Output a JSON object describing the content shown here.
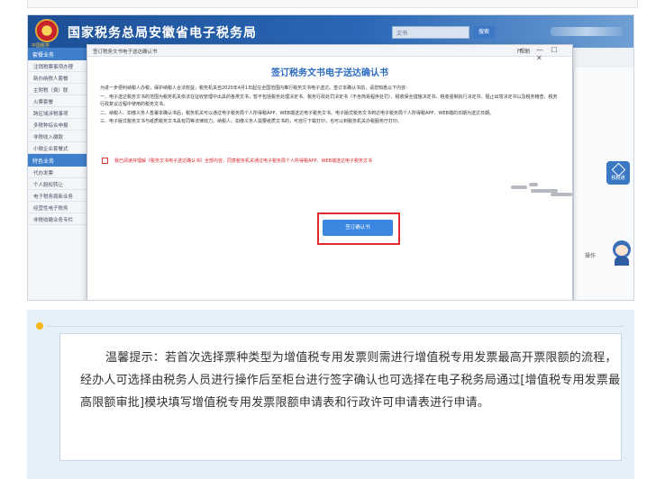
{
  "site": {
    "title": "国家税务总局安徽省电子税务局",
    "emblem_label": "中国税务",
    "search_placeholder": "文书",
    "search_button": "搜索"
  },
  "sidebar": {
    "section1": "套餐业务",
    "section1_items": [
      "注销税票事项办理",
      "新办纳税人套餐",
      "主附税（费）联",
      "火票套餐",
      "跨区域涉税事项",
      "多税种综合申报",
      "非税收入缴款",
      "小微企业套餐式"
    ],
    "section2": "特色业务",
    "section2_items": [
      "代办发票",
      "个人股权转让",
      "电子税务局新业务",
      "经营性电子税务",
      "非税收缴业务专栏"
    ]
  },
  "modal": {
    "window_title": "签订税务文书电子送达确认书",
    "help": "?帮助",
    "controls": "— ☐ ✕",
    "heading": "签订税务文书电子送达确认书",
    "intro": "为进一步便利纳税人办税，保护纳税人合法权益，税务机关自2020年4月1日起在全国范围内推行税务文书电子送达。签订本确认书前，请您知悉以下内容：",
    "para1": "一、电子送达税务文书的范围为税务机关依法在征收管理中出具的各类文书，暂不包括税务处理决定书、税务行政处罚决定书（不含简易程序处罚）、税收保全措施决定书、税收强制执行决定书、阻止出境决定书以及税务稽查、税务行政复议过程中使用的税务文书。",
    "para2": "二、纳税人、扣缴义务人签署本确认书后，税务机关可以通过电子税务局个人所得税APP、WEB端送达电子税务文书。电子版式税务文书到达电子税务局个人所得税APP、WEB端的日期为送达日期。",
    "para3": "三、电子版式税务文书与纸质税务文书具有同等法律效力。纳税人、扣缴义务人需要纸质文书的，可自行下载打印，也可以到税务机关办税服务厅打印。",
    "agree_text": "我已阅读并理解《税务文书电子送达确认书》全部内容，同意税务机关通过电子税务局个人所得税APP、WEB端送达电子税务文书",
    "confirm_button": "签订确认书"
  },
  "page_aside": {
    "operation_label": "操作",
    "tool_label": "税税通"
  },
  "tip": {
    "text": "温馨提示：若首次选择票种类型为增值税专用发票则需进行增值税专用发票最高开票限额的流程，经办人可选择由税务人员进行操作后至柜台进行签字确认也可选择在电子税务局通过[增值税专用发票最高限额审批]模块填写增值税专用发票限额申请表和行政许可申请表进行申请。"
  },
  "colors": {
    "header_blue": "#2a67b6",
    "accent_blue": "#2c6bc2",
    "warning_red": "#d4262a",
    "tip_bg": "#e6f0f9",
    "tip_dot": "#f5b719"
  }
}
